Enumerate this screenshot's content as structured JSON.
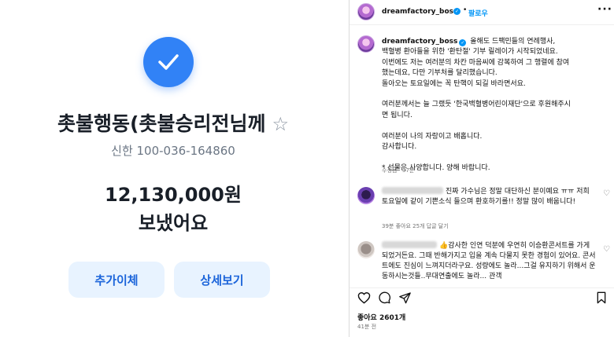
{
  "transfer": {
    "recipient": "촛불행동(촛불승리전님께",
    "star_icon": "star-icon",
    "account": "신한 100-036-164860",
    "amount": "12,130,000원",
    "status": "보냈어요",
    "buttons": {
      "add": "추가이체",
      "detail": "상세보기"
    },
    "accent": "#3182f6"
  },
  "post": {
    "username": "dreamfactory_boss",
    "separator": "•",
    "follow_label": "팔로우",
    "caption_lines": [
      "올해도 드팩민들의 연례행사,",
      "백혈병 환아들을 위한 '환탄절' 기부 릴레이가 시작되었네요.",
      "이번에도 저는 여러분의 차칸 마음씨에 감복하여 그 행렬에 참여",
      "했는데요, 다만 기부처를 달리했습니다.",
      "돌아오는 토요일에는 꼭 탄핵이 되길 바라면서요.",
      "",
      "여러분께서는 늘 그랬듯 '한국백혈병어린이재단'으로 후원해주시",
      "면 됩니다.",
      "",
      "여러분이 나의 자랑이고 배홉니다.",
      "감사합니다.",
      "",
      "* 선물은 사양합니다. 양해 바랍니다."
    ],
    "edited": "수정됨 · 37분",
    "comments": [
      {
        "text": "진짜 가수님은 정말 대단하신 분이예요 ㅠㅠ 저희 토요일에 같이 기쁜소식 들으며 환호하기를!! 정말 많이 배웁니다!",
        "meta": "39분   좋아요 25개   답글 달기"
      },
      {
        "text": "👍감사한 인연 덕분에 우연히 이승환콘서트를 가게 되었거든요. 그때 반해가지고 입을 계속 다물지 못한 경험이 있어요. 콘서트에도 진심이 느껴지더라구요. 성량에도 놀라...그걸 유지하기 위해서 운동하시는것들..무대연출에도 놀라... 관객"
      }
    ],
    "likes": "좋아요 2601개",
    "time": "41분 전",
    "colors": {
      "link": "#0095f6",
      "muted": "#737373"
    }
  }
}
